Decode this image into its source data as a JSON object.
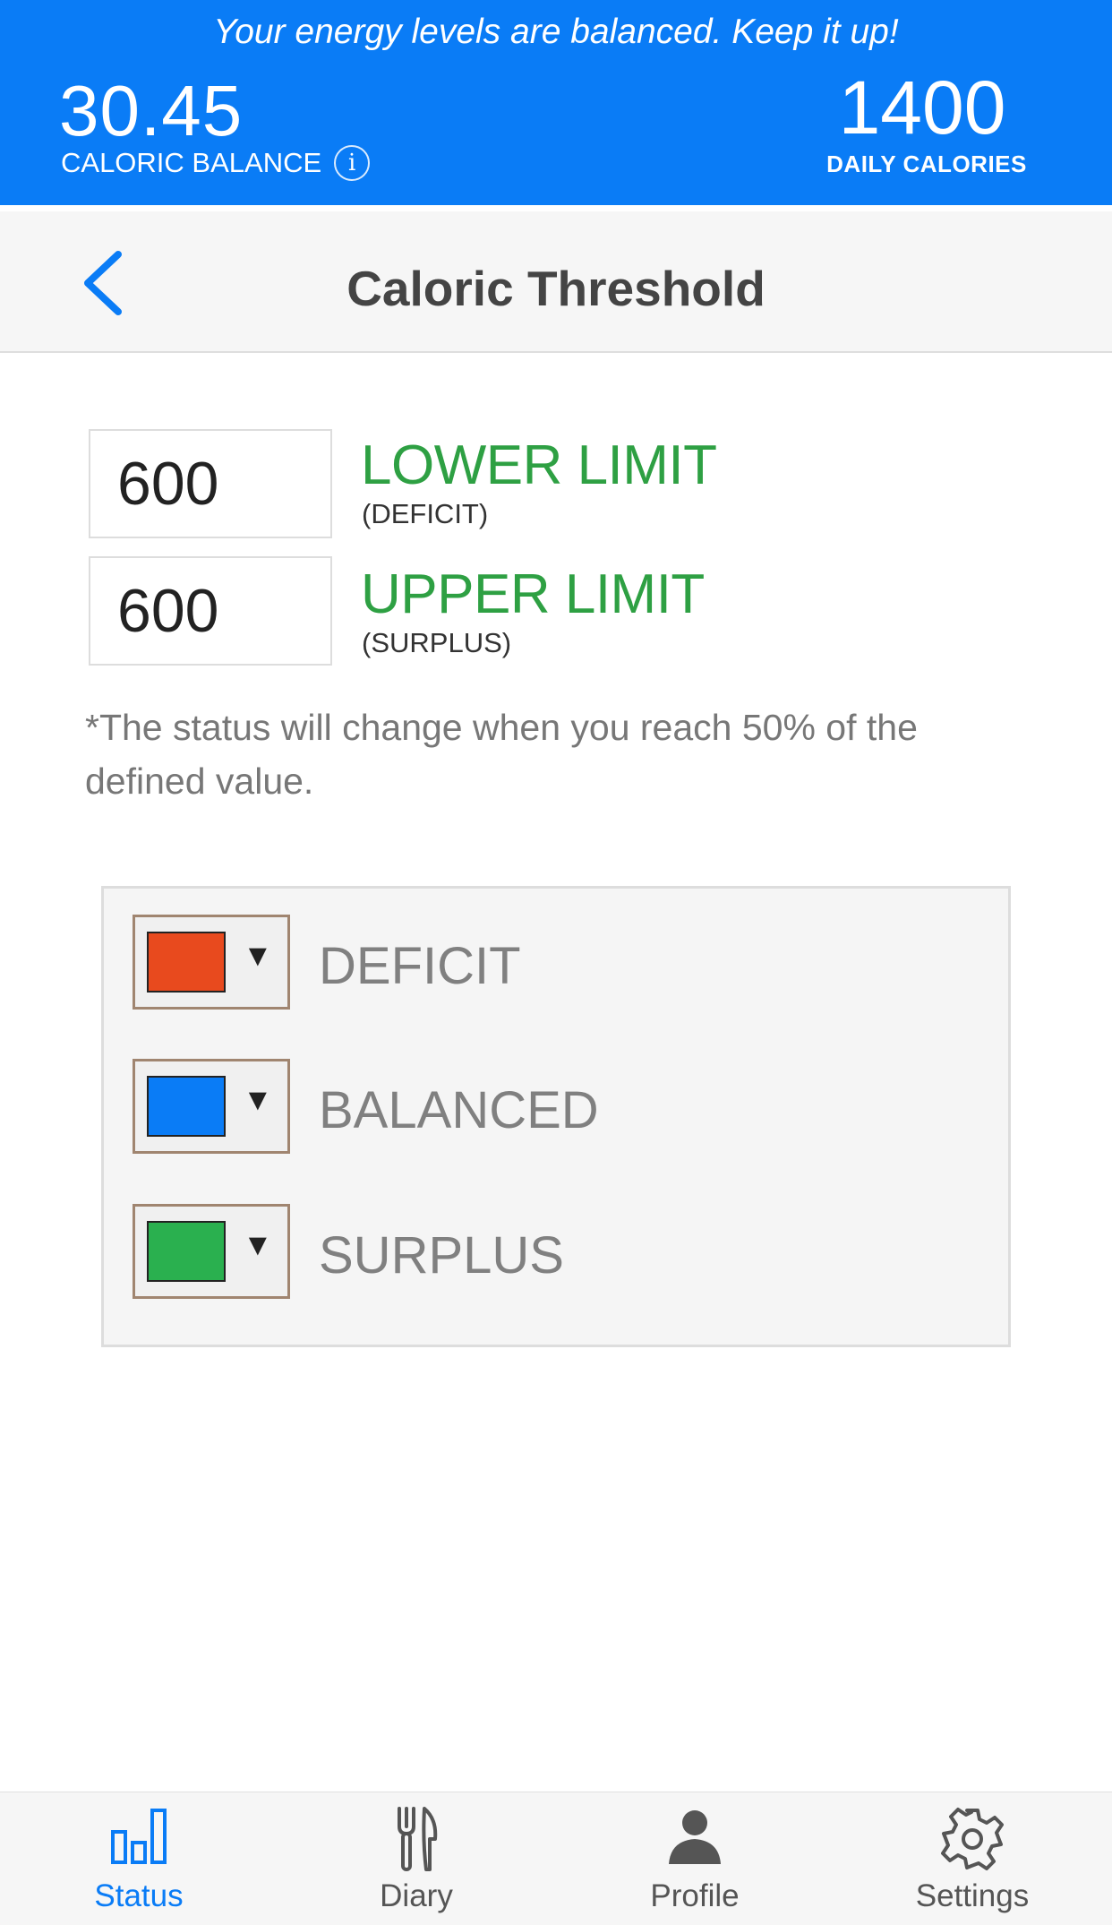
{
  "status_banner": {
    "message": "Your energy levels are balanced. Keep it up!",
    "balance_value": "30.45",
    "balance_label": "CALORIC BALANCE",
    "info_icon_glyph": "i",
    "daily_calories_value": "1400",
    "daily_calories_label": "DAILY CALORIES",
    "background_color": "#0a7cf6"
  },
  "navbar": {
    "title": "Caloric Threshold",
    "back_icon": "chevron-left-icon"
  },
  "limits": {
    "lower": {
      "value": "600",
      "title": "LOWER LIMIT",
      "subtitle": "(DEFICIT)"
    },
    "upper": {
      "value": "600",
      "title": "UPPER LIMIT",
      "subtitle": "(SURPLUS)"
    },
    "accent_color": "#2ea043"
  },
  "note": "*The status will change when you reach 50% of the defined value.",
  "status_colors": [
    {
      "label": "DEFICIT",
      "color": "#e84a1e"
    },
    {
      "label": "BALANCED",
      "color": "#0a7cf6"
    },
    {
      "label": "SURPLUS",
      "color": "#2ab04f"
    }
  ],
  "dropdown_arrow": "▼",
  "tabbar": {
    "tabs": [
      {
        "label": "Status",
        "icon": "bar-chart-icon",
        "active": true
      },
      {
        "label": "Diary",
        "icon": "fork-knife-icon",
        "active": false
      },
      {
        "label": "Profile",
        "icon": "person-icon",
        "active": false
      },
      {
        "label": "Settings",
        "icon": "gear-icon",
        "active": false
      }
    ],
    "active_color": "#0a7cf6"
  }
}
